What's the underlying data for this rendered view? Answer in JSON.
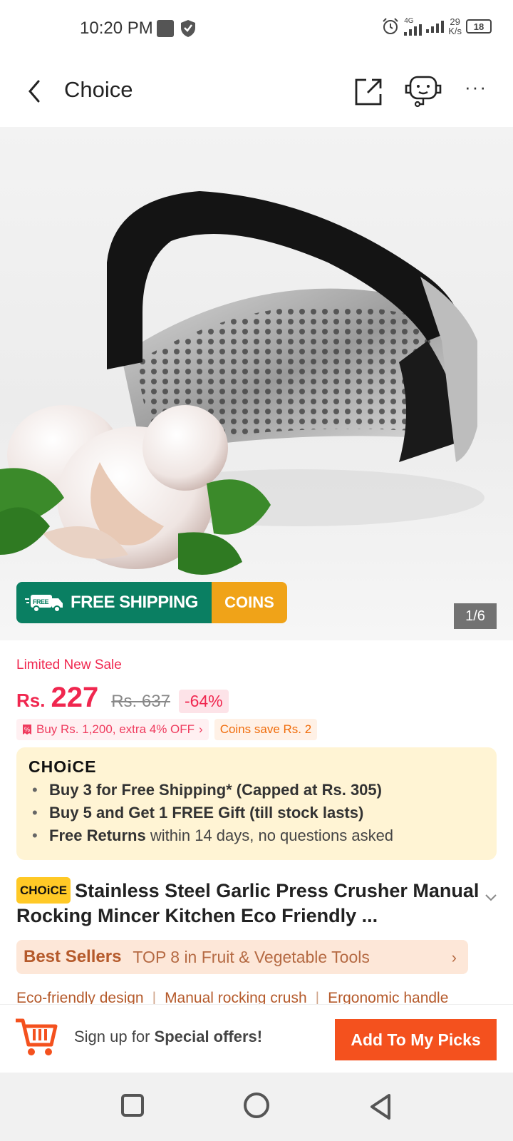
{
  "status_bar": {
    "time": "10:20 PM",
    "network": "4G",
    "speed_value": "29",
    "speed_unit": "K/s",
    "battery": "18"
  },
  "header": {
    "title": "Choice",
    "icons": [
      "back-arrow-icon",
      "share-icon",
      "chatbot-icon",
      "more-icon"
    ]
  },
  "hero": {
    "shipping_badge": "FREE SHIPPING",
    "shipping_badge_truck_text": "FREE",
    "coins_badge": "COINS",
    "pager": "1/6"
  },
  "pricing": {
    "limited_label": "Limited New Sale",
    "currency": "Rs.",
    "price": "227",
    "original_price": "Rs. 637",
    "discount": "-64%",
    "promo_extra": "Buy Rs. 1,200, extra 4% OFF",
    "promo_coins": "Coins save Rs. 2"
  },
  "choice_box": {
    "logo": "CHOiCE",
    "items": [
      {
        "bold": "Buy 3 for  Free Shipping* (Capped at Rs. 305)",
        "rest": ""
      },
      {
        "bold": "Buy 5 and Get 1 FREE Gift (till stock lasts)",
        "rest": ""
      },
      {
        "bold": "Free Returns",
        "rest": " within 14 days, no questions asked"
      }
    ]
  },
  "product": {
    "badge": "CHOiCE",
    "title": "Stainless Steel Garlic Press Crusher Manual Rocking Mincer Kitchen Eco Friendly ..."
  },
  "best_sellers": {
    "logo": "Best Sellers",
    "text": "TOP 8 in Fruit & Vegetable Tools"
  },
  "tags": [
    "Eco-friendly design",
    "Manual rocking crush",
    "Ergonomic handle"
  ],
  "bottom_bar": {
    "signup_prefix": "Sign up for ",
    "signup_bold": "Special offers!",
    "add_button": "Add To My Picks"
  },
  "colors": {
    "accent_red": "#f0274f",
    "cta_orange": "#f4511e",
    "shipping_green": "#0a7f62",
    "coins_orange": "#f0a318",
    "choice_bg": "#fff4d4"
  }
}
